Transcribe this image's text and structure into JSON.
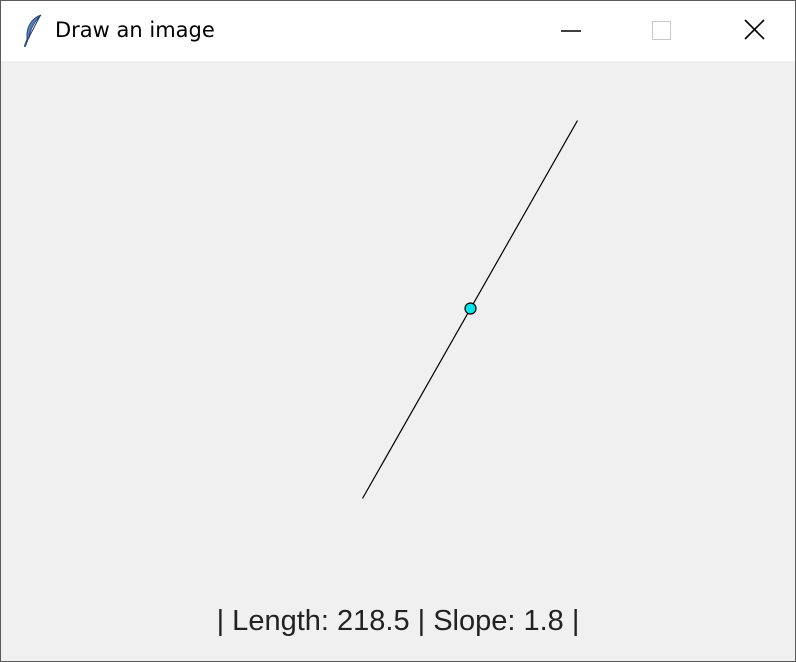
{
  "window": {
    "title": "Draw an image",
    "app_icon": "feather-icon",
    "controls": [
      "minimize-icon",
      "maximize-icon",
      "close-icon"
    ]
  },
  "canvas": {
    "background": "#f0f0f0",
    "line_color": "#000000",
    "marker_color": "#00e5ee"
  },
  "status": {
    "text": "| Length: 218.5 | Slope: 1.8 |"
  }
}
